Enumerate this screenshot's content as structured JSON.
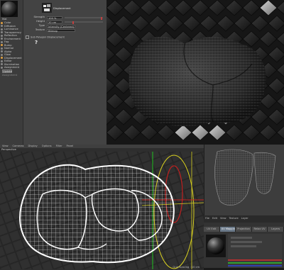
{
  "material_editor": {
    "preview_name": "Mat",
    "channels": [
      {
        "label": "Color",
        "on": true
      },
      {
        "label": "Diffusion",
        "on": false
      },
      {
        "label": "Luminance",
        "on": false
      },
      {
        "label": "Transparency",
        "on": false
      },
      {
        "label": "Reflection",
        "on": false
      },
      {
        "label": "Environment",
        "on": false
      },
      {
        "label": "Fog",
        "on": false
      },
      {
        "label": "Bump",
        "on": true
      },
      {
        "label": "Normal",
        "on": false
      },
      {
        "label": "Alpha",
        "on": false
      },
      {
        "label": "Glow",
        "on": false
      },
      {
        "label": "Displacement",
        "on": true
      },
      {
        "label": "Editor",
        "on": false
      },
      {
        "label": "Illumination",
        "on": false
      },
      {
        "label": "Assignment",
        "on": false
      }
    ],
    "update_button": "Update",
    "footer_label": "Assignment",
    "props": {
      "section_title": "Displacement",
      "rows": [
        {
          "label": "Strength",
          "value": "100 %"
        },
        {
          "label": "Height",
          "value": "20 cm"
        },
        {
          "label": "Type",
          "value": "Intensity (Centered)"
        },
        {
          "label": "Texture",
          "value": "Bitmap"
        }
      ],
      "sub_polygon_label": "Sub Polygon Displacement",
      "help_glyph": "?"
    }
  },
  "viewport_bottom": {
    "menu": [
      "View",
      "Cameras",
      "Display",
      "Options",
      "Filter",
      "Panel"
    ],
    "title": "Perspective",
    "status": "Grid Spacing : 10 cm"
  },
  "uv_panel": {
    "tabs": [
      "UV Edit",
      "UV Mapping",
      "Projection",
      "Relax UV",
      "Layers"
    ],
    "toolbar": [
      "File",
      "Edit",
      "View",
      "Texture",
      "Layer"
    ]
  },
  "status_bar": {
    "left": "Object",
    "right": ""
  }
}
